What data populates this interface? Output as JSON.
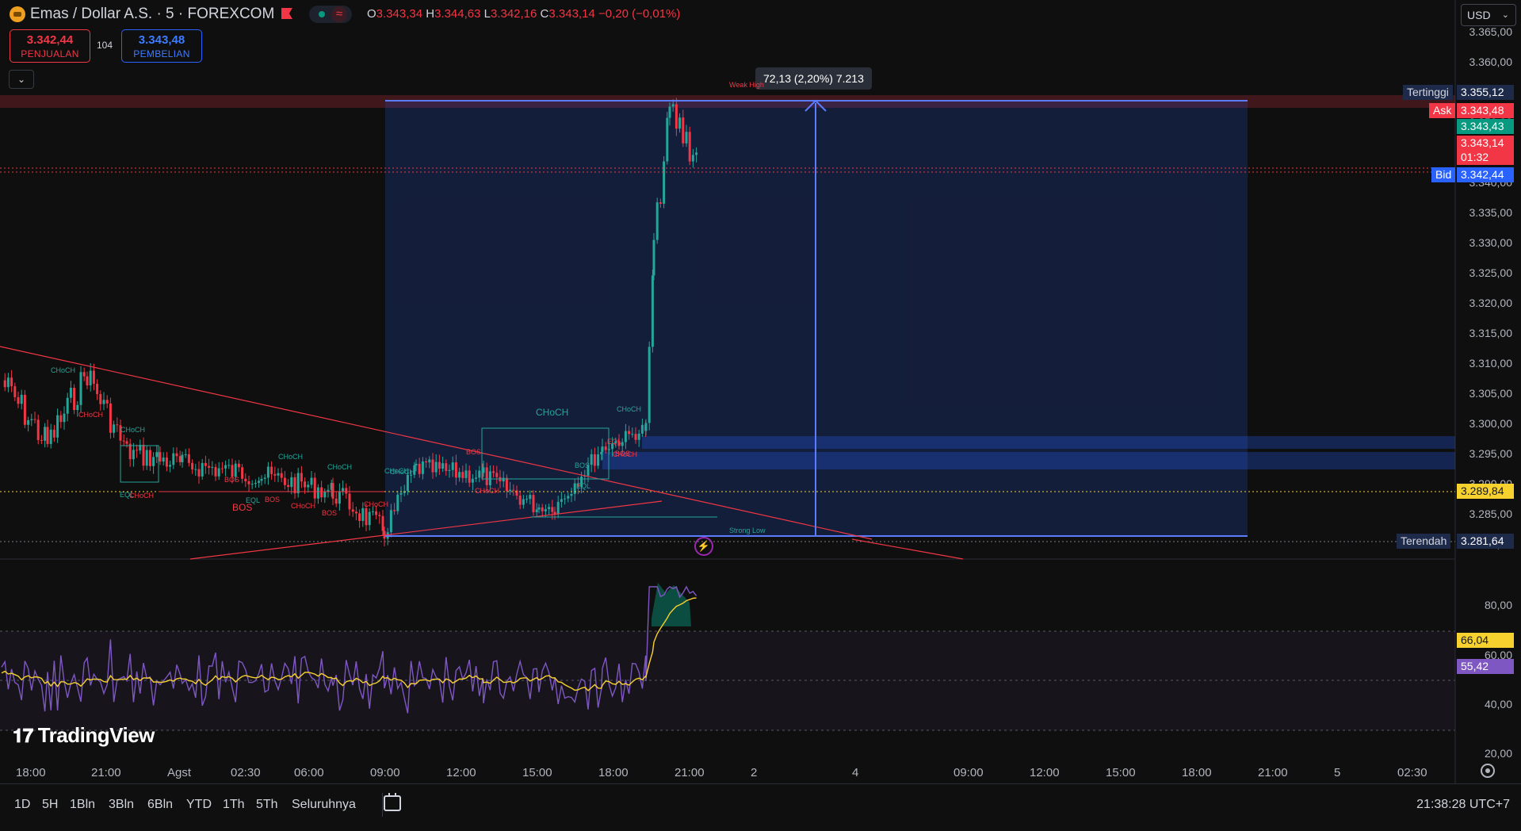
{
  "header": {
    "symbol_title": "Emas / Dollar A.S. · 5 · FOREXCOM",
    "ohlc": {
      "o_label": "O",
      "o": "3.343,34",
      "h_label": "H",
      "h": "3.344,63",
      "l_label": "L",
      "l": "3.342,16",
      "c_label": "C",
      "c": "3.343,14",
      "change": "−0,20 (−0,01%)"
    },
    "icons": [
      "gold-coin-icon",
      "flag-icon",
      "live-dot-icon",
      "wave-icon"
    ]
  },
  "trade": {
    "sell_price": "3.342,44",
    "sell_label": "PENJUALAN",
    "spread": "104",
    "buy_price": "3.343,48",
    "buy_label": "PEMBELIAN",
    "collapse_glyph": "⌄"
  },
  "currency_select": {
    "value": "USD",
    "chevron": "⌄"
  },
  "price_axis": {
    "ticks": [
      "3.365,00",
      "3.360,00",
      "3.355,00",
      "3.350,00",
      "3.345,00",
      "3.340,00",
      "3.335,00",
      "3.330,00",
      "3.325,00",
      "3.320,00",
      "3.315,00",
      "3.310,00",
      "3.305,00",
      "3.300,00",
      "3.295,00",
      "3.290,00",
      "3.285,00",
      "3.280,00"
    ]
  },
  "price_labels": {
    "high_name": "Tertinggi",
    "high_value": "3.355,12",
    "ask_name": "Ask",
    "ask_value": "3.343,48",
    "mid_value": "3.343,43",
    "last_value": "3.343,14",
    "countdown": "01:32",
    "bid_name": "Bid",
    "bid_value": "3.342,44",
    "level_value": "3.289,84",
    "low_name": "Terendah",
    "low_value": "3.281,64"
  },
  "measure_tooltip": "72,13 (2,20%) 7.213",
  "annotations": {
    "weak_high": "Weak High",
    "strong_low": "Strong Low",
    "choch_big": "CHoCH",
    "bos_big": "BOS",
    "small": [
      {
        "t": "CHoCH",
        "c": "#26a69a"
      },
      {
        "t": "CHoCH",
        "c": "#f23645"
      },
      {
        "t": "CHoCH",
        "c": "#26a69a"
      },
      {
        "t": "CHoCH",
        "c": "#26a69a"
      },
      {
        "t": "CHoCH",
        "c": "#26a69a"
      },
      {
        "t": "CHoCH",
        "c": "#26a69a"
      },
      {
        "t": "CHoCH",
        "c": "#f23645"
      },
      {
        "t": "CHoCH",
        "c": "#f23645"
      },
      {
        "t": "CHoCH",
        "c": "#f23645"
      },
      {
        "t": "CHoCH",
        "c": "#26a69a"
      },
      {
        "t": "CHoCH",
        "c": "#26a69a"
      },
      {
        "t": "CHoCH",
        "c": "#f23645"
      },
      {
        "t": "BOS",
        "c": "#f23645"
      },
      {
        "t": "BOS",
        "c": "#f23645"
      },
      {
        "t": "BOS",
        "c": "#f23645"
      },
      {
        "t": "BOS",
        "c": "#f23645"
      },
      {
        "t": "BOS",
        "c": "#26a69a"
      },
      {
        "t": "BOS",
        "c": "#f23645"
      },
      {
        "t": "EQL",
        "c": "#26a69a"
      },
      {
        "t": "EQL",
        "c": "#26a69a"
      },
      {
        "t": "EQL",
        "c": "#26a69a"
      },
      {
        "t": "EQL",
        "c": "#f23645"
      },
      {
        "t": "CHoCH",
        "c": "#f23645"
      }
    ]
  },
  "rsi": {
    "axis_ticks": [
      "80,00",
      "60,00",
      "40,00",
      "20,00"
    ],
    "rsi_value": "55,42",
    "ma_value": "66,04"
  },
  "time_axis": {
    "labels": [
      "18:00",
      "21:00",
      "Agst",
      "02:30",
      "06:00",
      "09:00",
      "12:00",
      "15:00",
      "18:00",
      "21:00",
      "2",
      "4",
      "09:00",
      "12:00",
      "15:00",
      "18:00",
      "21:00",
      "5",
      "02:30"
    ]
  },
  "bottom_bar": {
    "periods": [
      "1D",
      "5H",
      "1Bln",
      "3Bln",
      "6Bln",
      "YTD",
      "1Th",
      "5Th",
      "Seluruhnya"
    ],
    "clock": "21:38:28 UTC+7"
  },
  "branding": {
    "logo_text": "TradingView",
    "logo_mark": "𝟏𝟕"
  },
  "colors": {
    "bull": "#26a69a",
    "bear": "#f23645",
    "accent": "#2962ff",
    "rsi_line": "#7e57c2",
    "rsi_ma": "#f7d12e",
    "level": "#f7d12e"
  }
}
